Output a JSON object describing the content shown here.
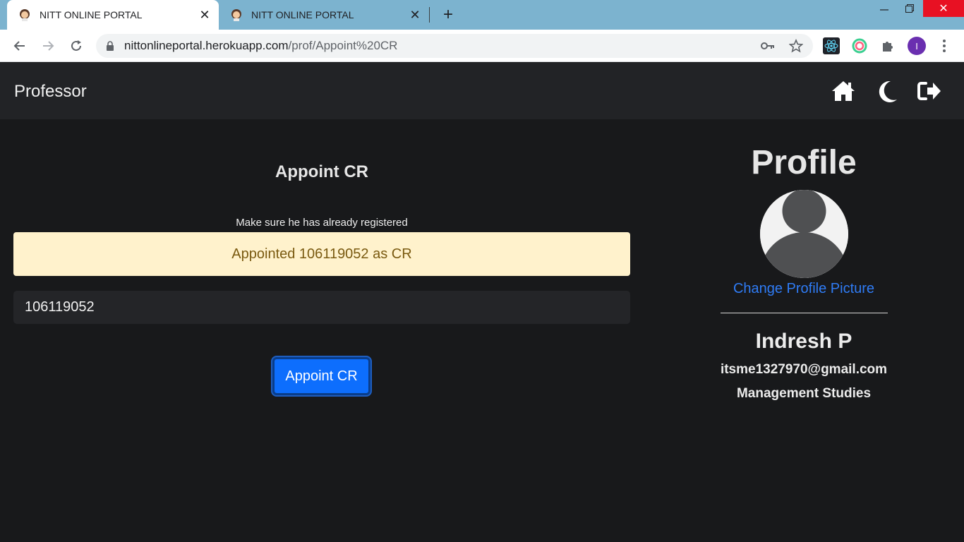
{
  "browser": {
    "tabs": [
      {
        "title": "NITT ONLINE PORTAL",
        "active": true
      },
      {
        "title": "NITT ONLINE PORTAL",
        "active": false
      }
    ],
    "url_host": "nittonlineportal.herokuapp.com",
    "url_path": "/prof/Appoint%20CR",
    "profile_initial": "I",
    "colors": {
      "tabbar": "#7cb3cf",
      "close_button": "#e81123",
      "profile_chip": "#6a2fb0"
    }
  },
  "navbar": {
    "brand": "Professor",
    "icons": [
      "home-icon",
      "moon-icon",
      "logout-icon"
    ]
  },
  "appoint": {
    "title": "Appoint CR",
    "hint": "Make sure he has already registered",
    "alert_message": "Appointed 106119052 as CR",
    "input_value": "106119052",
    "button_label": "Appoint CR"
  },
  "profile": {
    "heading": "Profile",
    "change_picture_link": "Change Profile Picture",
    "name": "Indresh P",
    "email": "itsme1327970@gmail.com",
    "department": "Management Studies"
  },
  "theme": {
    "background": "#18191b",
    "navbar": "#222326",
    "alert_bg": "#fff2cc",
    "alert_text": "#7a5a10",
    "primary": "#0d6efd",
    "link": "#2f7cf6"
  }
}
